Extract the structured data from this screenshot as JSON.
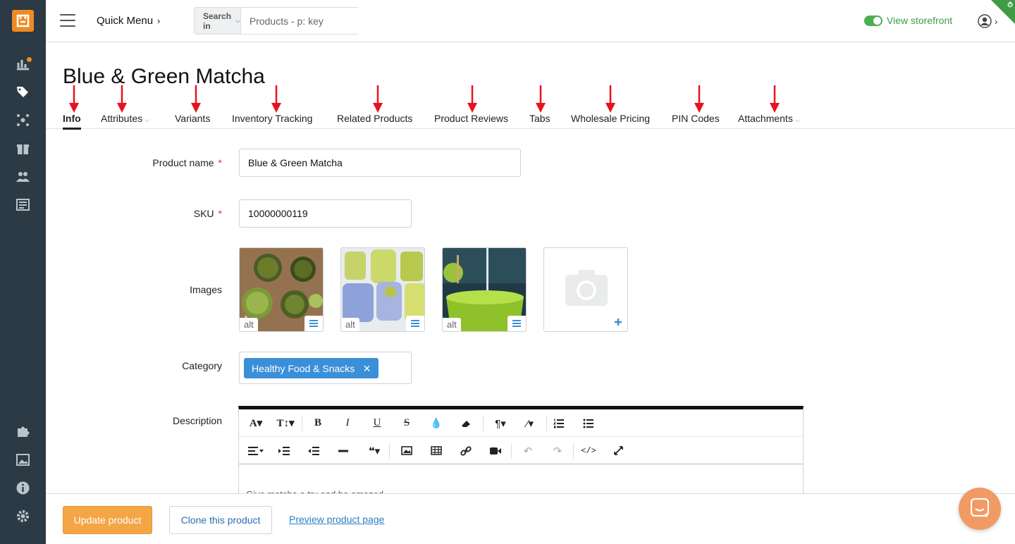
{
  "topbar": {
    "quick_menu": "Quick Menu",
    "search_in": "Search in",
    "search_placeholder": "Products - p: key",
    "view_storefront": "View storefront"
  },
  "page": {
    "title": "Blue & Green Matcha"
  },
  "tabs": [
    {
      "label": "Info",
      "active": true
    },
    {
      "label": "Attributes",
      "dropdown": true
    },
    {
      "label": "Variants"
    },
    {
      "label": "Inventory Tracking"
    },
    {
      "label": "Related Products"
    },
    {
      "label": "Product Reviews"
    },
    {
      "label": "Tabs"
    },
    {
      "label": "Wholesale Pricing"
    },
    {
      "label": "PIN Codes"
    },
    {
      "label": "Attachments",
      "dropdown": true
    }
  ],
  "form": {
    "product_name_label": "Product name",
    "product_name_value": "Blue & Green Matcha",
    "sku_label": "SKU",
    "sku_value": "10000000119",
    "required_mark": "*",
    "images_label": "Images",
    "image_alt_label": "alt",
    "category_label": "Category",
    "category_chip": "Healthy Food & Snacks",
    "description_label": "Description",
    "description_text": "Give matcha a try and be amazed"
  },
  "bottom": {
    "update_button": "Update product",
    "clone_button": "Clone this product",
    "preview_link": "Preview product page"
  },
  "colors": {
    "sidebar": "#2b3a44",
    "accent_orange": "#f4a546",
    "chip_blue": "#3a8fd8",
    "storefront_green": "#3a9d4a",
    "annotation_red": "#e8121d"
  }
}
